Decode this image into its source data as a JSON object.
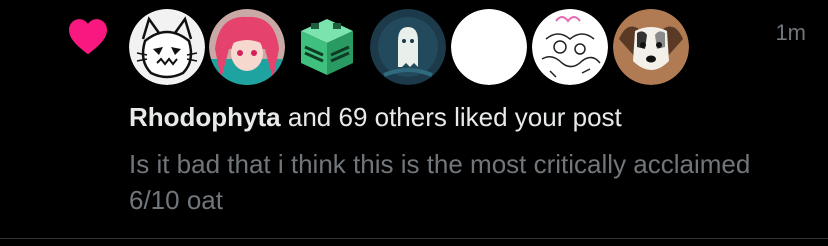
{
  "notification": {
    "icon": "heart-icon",
    "heart_color": "#f91880",
    "timestamp": "1m",
    "actor_name": "Rhodophyta",
    "action_text": " and 69 others liked your post",
    "post_preview": "Is it bad that i think this is the most critically acclaimed 6/10 oat",
    "avatars": [
      {
        "name": "avatar-white-cat-drawing"
      },
      {
        "name": "avatar-pink-hair-anime"
      },
      {
        "name": "avatar-green-cube"
      },
      {
        "name": "avatar-ghost-dark"
      },
      {
        "name": "avatar-white-circle"
      },
      {
        "name": "avatar-doodle-drawing"
      },
      {
        "name": "avatar-dog-photo"
      }
    ]
  },
  "colors": {
    "background": "#000000",
    "primary_text": "#e7e9ea",
    "secondary_text": "#71767b",
    "divider": "#2f3336"
  }
}
